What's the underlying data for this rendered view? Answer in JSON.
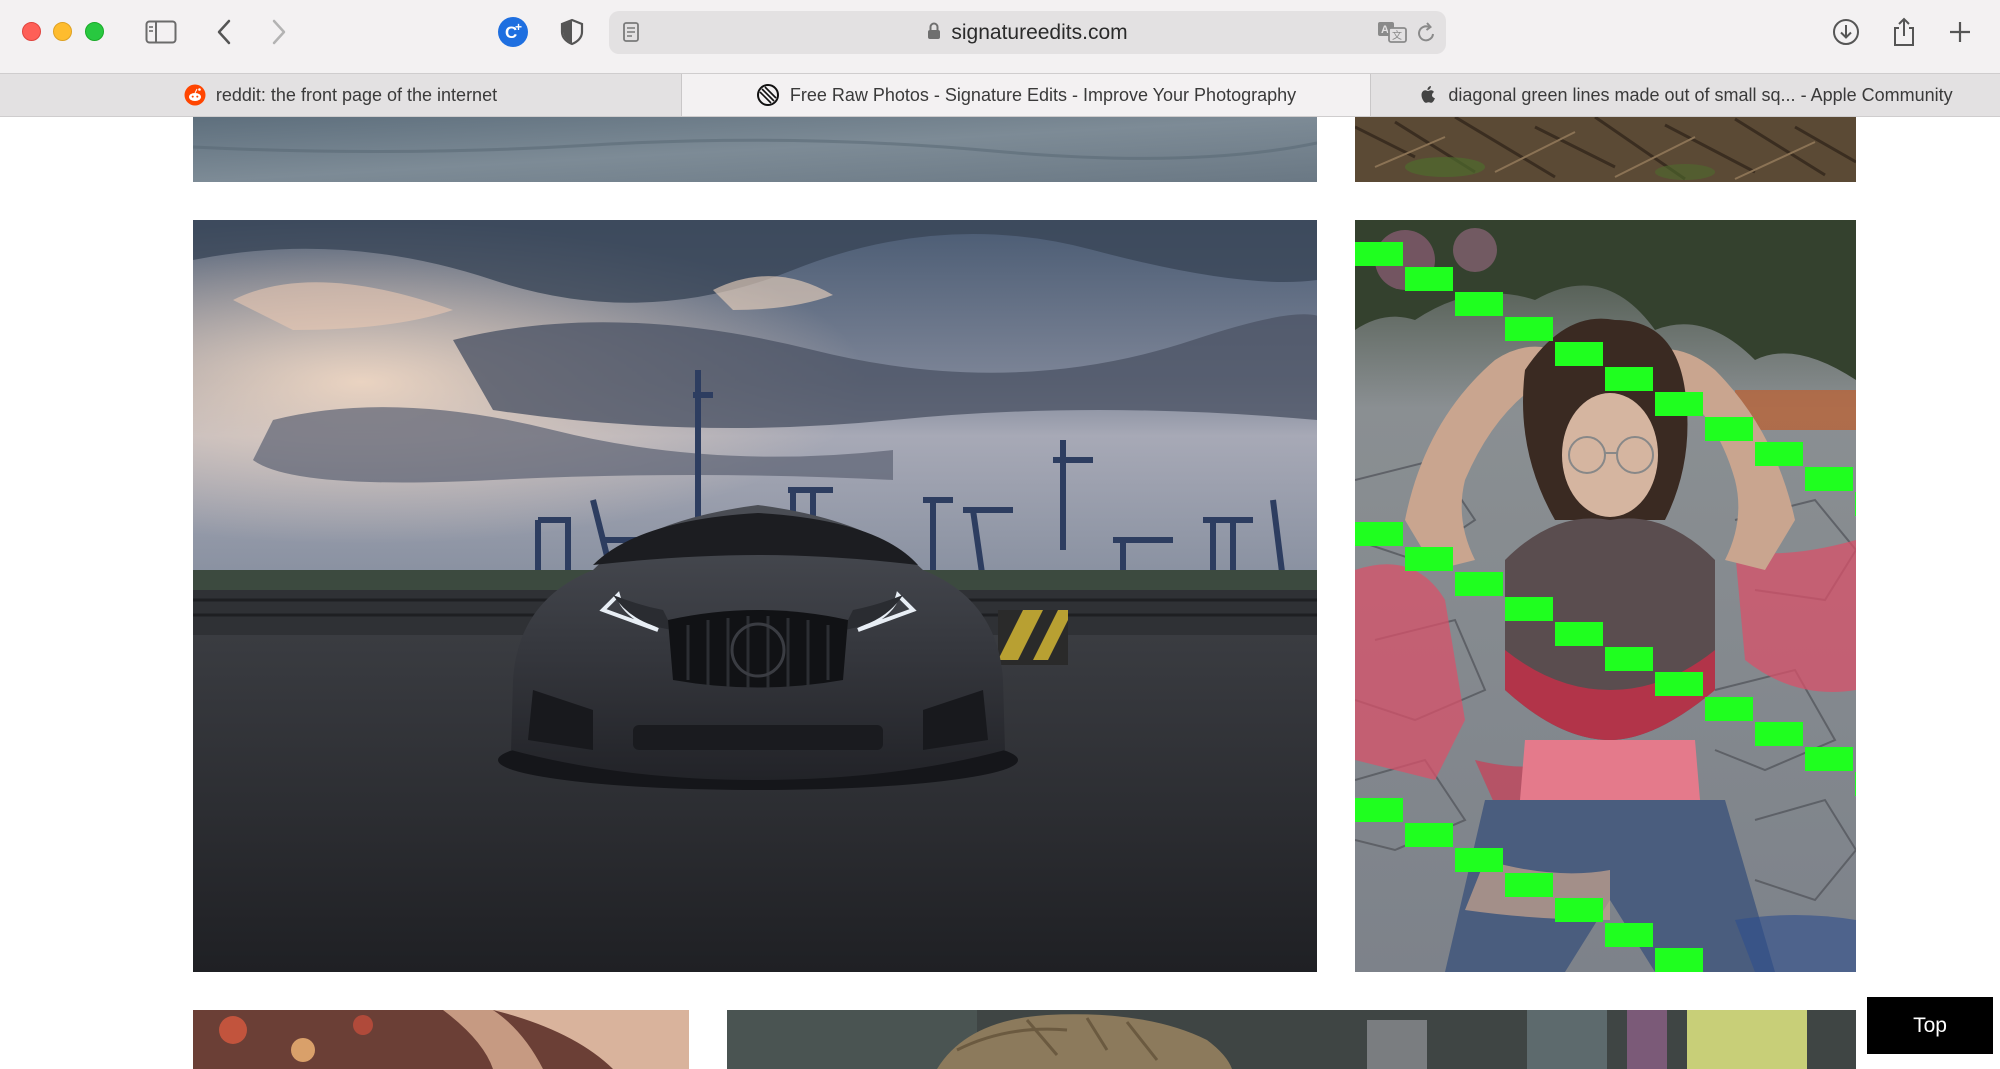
{
  "browser": {
    "url": "signatureedits.com",
    "tabs": [
      {
        "title": "reddit: the front page of the internet",
        "favicon": "reddit-icon",
        "active": false
      },
      {
        "title": "Free Raw Photos - Signature Edits - Improve Your Photography",
        "favicon": "signature-edits-icon",
        "active": true
      },
      {
        "title": "diagonal green lines made out of small sq... - Apple Community",
        "favicon": "apple-icon",
        "active": false
      }
    ],
    "toolbar_icons": [
      "sidebar-icon",
      "back-icon",
      "forward-icon",
      "extension-c-plus-icon",
      "privacy-shield-icon",
      "reader-icon",
      "translate-icon",
      "reload-icon",
      "downloads-icon",
      "share-icon",
      "new-tab-icon"
    ],
    "colors": {
      "toolbar_bg": "#f3f1f2",
      "tabbar_bg": "#e3e1e2",
      "artifact_green": "#1fff1f"
    }
  },
  "page": {
    "photos": [
      {
        "name": "partial-top-left-concrete"
      },
      {
        "name": "partial-top-right-ground"
      },
      {
        "name": "black-sports-car-at-port"
      },
      {
        "name": "woman-hands-in-hair"
      },
      {
        "name": "partial-bottom-left-floral"
      },
      {
        "name": "partial-bottom-right-hair"
      }
    ],
    "top_button": "Top"
  }
}
